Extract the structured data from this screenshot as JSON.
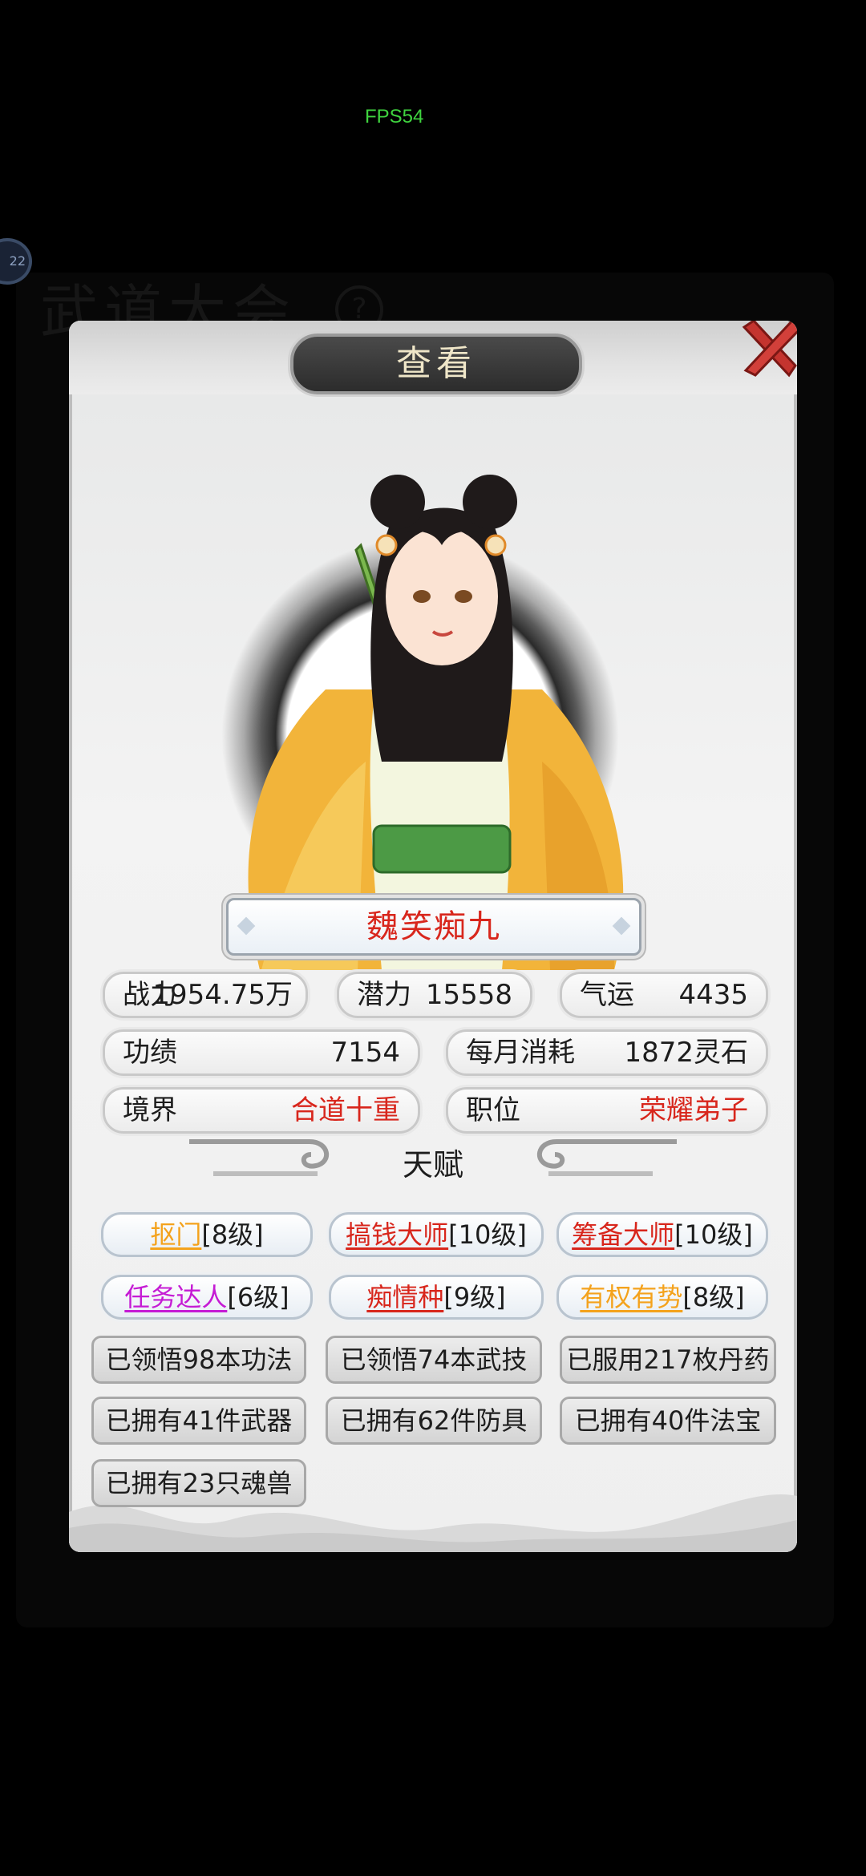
{
  "hud": {
    "fps": "FPS54"
  },
  "background": {
    "title": "武道大会"
  },
  "dialog": {
    "title": "查看"
  },
  "character": {
    "name": "魏笑痴九"
  },
  "stats": {
    "power_label": "战力",
    "power_value": "1954.75万",
    "potential_label": "潜力",
    "potential_value": "15558",
    "luck_label": "气运",
    "luck_value": "4435",
    "merit_label": "功绩",
    "merit_value": "7154",
    "monthly_label": "每月消耗",
    "monthly_value": "1872灵石",
    "realm_label": "境界",
    "realm_value": "合道十重",
    "position_label": "职位",
    "position_value": "荣耀弟子"
  },
  "talent_section": {
    "title": "天赋"
  },
  "talents": [
    {
      "name": "抠门",
      "level": "[8级]",
      "color": "#f4a21c"
    },
    {
      "name": "搞钱大师",
      "level": "[10级]",
      "color": "#d8261c"
    },
    {
      "name": "筹备大师",
      "level": "[10级]",
      "color": "#d8261c"
    },
    {
      "name": "任务达人",
      "level": "[6级]",
      "color": "#c51bd4"
    },
    {
      "name": "痴情种",
      "level": "[9级]",
      "color": "#d8261c"
    },
    {
      "name": "有权有势",
      "level": "[8级]",
      "color": "#f4a21c"
    }
  ],
  "achievements": [
    "已领悟98本功法",
    "已领悟74本武技",
    "已服用217枚丹药",
    "已拥有41件武器",
    "已拥有62件防具",
    "已拥有40件法宝",
    "已拥有23只魂兽"
  ],
  "colors": {
    "accent_red": "#d8261c",
    "orange": "#f4a21c",
    "purple": "#c51bd4"
  }
}
